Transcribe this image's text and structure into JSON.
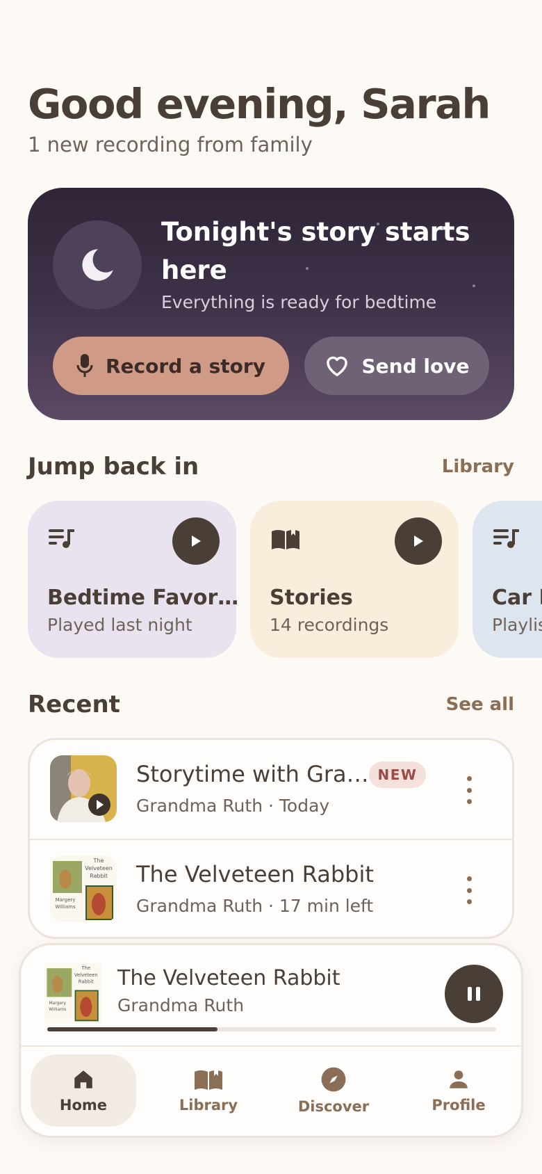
{
  "greeting": {
    "title": "Good evening, Sarah",
    "subtitle": "1 new recording from family"
  },
  "hero": {
    "title": "Tonight's story starts here",
    "subtitle": "Everything is ready for bedtime",
    "record_label": "Record a story",
    "love_label": "Send love"
  },
  "jump": {
    "title": "Jump back in",
    "link": "Library",
    "tiles": [
      {
        "name": "Bedtime Favor…",
        "sub": "Played last night",
        "icon": "playlist-icon",
        "bg": "#e8e3ef"
      },
      {
        "name": "Stories",
        "sub": "14 recordings",
        "icon": "book-icon",
        "bg": "#f9eedb"
      },
      {
        "name": "Car R",
        "sub": "Playlis",
        "icon": "playlist-icon",
        "bg": "#dde5ee"
      }
    ]
  },
  "recent": {
    "title": "Recent",
    "link": "See all",
    "items": [
      {
        "title": "Storytime with Gra…",
        "sub": "Grandma Ruth · Today",
        "badge": "NEW"
      },
      {
        "title": "The Velveteen Rabbit",
        "sub": "Grandma Ruth · 17 min left"
      }
    ]
  },
  "book_cover": {
    "line1": "The",
    "line2": "Velveteen",
    "line3": "Rabbit",
    "author1": "Margery",
    "author2": "Williams"
  },
  "player": {
    "title": "The Velveteen Rabbit",
    "artist": "Grandma Ruth",
    "progress": 0.38
  },
  "nav": {
    "items": [
      {
        "label": "Home",
        "icon": "home-icon",
        "active": true
      },
      {
        "label": "Library",
        "icon": "library-icon",
        "active": false
      },
      {
        "label": "Discover",
        "icon": "compass-icon",
        "active": false
      },
      {
        "label": "Profile",
        "icon": "person-icon",
        "active": false
      }
    ]
  },
  "colors": {
    "background": "#fdf9f5",
    "text": "#4a3f37",
    "accent": "#cf9a86",
    "link": "#8a6e55",
    "hero_top": "#2e2536",
    "hero_bottom": "#5b4a63"
  }
}
